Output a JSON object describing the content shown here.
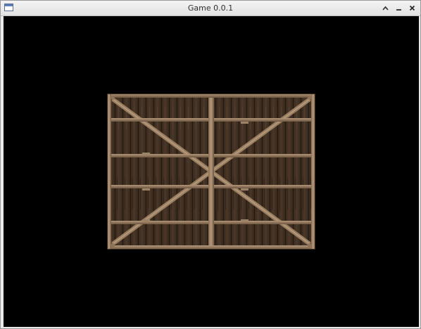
{
  "window": {
    "title": "Game 0.0.1",
    "controls": {
      "maximize_icon": "chevron-up-icon",
      "minimize_icon": "minimize-icon",
      "close_icon": "close-icon"
    }
  },
  "scene": {
    "background_color": "#000000",
    "sprite": "wooden-crate-face"
  }
}
